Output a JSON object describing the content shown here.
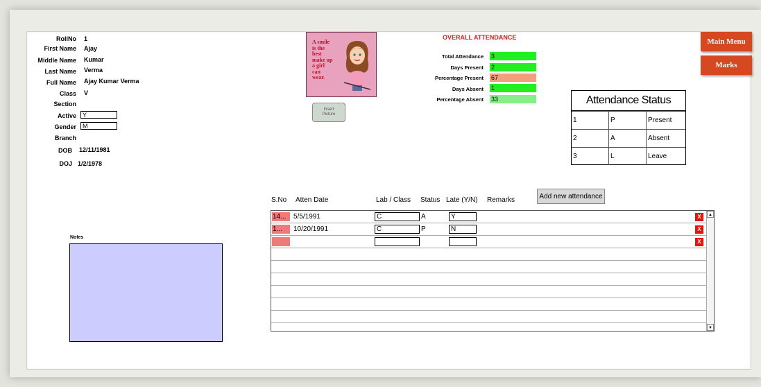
{
  "student": {
    "fields": [
      {
        "label": "RollNo",
        "value": "1"
      },
      {
        "label": "First Name",
        "value": "Ajay"
      },
      {
        "label": "Middle Name",
        "value": "Kumar"
      },
      {
        "label": "Last Name",
        "value": "Verma"
      },
      {
        "label": "Full Name",
        "value": "Ajay Kumar Verma"
      },
      {
        "label": "Class",
        "value": "V"
      },
      {
        "label": "Section",
        "value": ""
      }
    ],
    "active_label": "Active",
    "active_value": "Y",
    "gender_label": "Gender",
    "gender_value": "M",
    "branch_label": "Branch",
    "dob_label": "DOB",
    "dob_value": "12/11/1981",
    "doj_label": "DOJ",
    "doj_value": "1/2/1978"
  },
  "photo": {
    "quote_lines": [
      "A smile",
      "is the",
      "best",
      "make up",
      "a girl",
      "can",
      "wear."
    ],
    "insert_label_1": "Insert",
    "insert_label_2": "Picture"
  },
  "overall": {
    "title": "OVERALL ATTENDANCE",
    "stats": [
      {
        "label": "Total Attendance",
        "value": "3",
        "color": "#22ee22"
      },
      {
        "label": "Days Present",
        "value": "2",
        "color": "#22ee22"
      },
      {
        "label": "Percentage Present",
        "value": "67",
        "color": "#f2a07c"
      },
      {
        "label": "Days Absent",
        "value": "1",
        "color": "#22ee22"
      },
      {
        "label": "Percentage Absent",
        "value": "33",
        "color": "#88ee88"
      }
    ]
  },
  "nav": {
    "main_menu": "Main Menu",
    "marks": "Marks"
  },
  "legend": {
    "title": "Attendance Status",
    "rows": [
      {
        "n": "1",
        "code": "P",
        "text": "Present"
      },
      {
        "n": "2",
        "code": "A",
        "text": "Absent"
      },
      {
        "n": "3",
        "code": "L",
        "text": "Leave"
      }
    ]
  },
  "grid": {
    "headers": {
      "sno": "S.No",
      "date": "Atten Date",
      "lab": "Lab / Class",
      "status": "Status",
      "late": "Late (Y/N)",
      "remarks": "Remarks"
    },
    "add_label": "Add new attendance",
    "rows": [
      {
        "sno": "14...",
        "date": "5/5/1991",
        "lab": "C",
        "status": "A",
        "late": "Y"
      },
      {
        "sno": "1...",
        "date": "10/20/1991",
        "lab": "C",
        "status": "P",
        "late": "N"
      },
      {
        "sno": "",
        "date": "",
        "lab": "",
        "status": "",
        "late": ""
      }
    ],
    "delete_label": "X"
  },
  "notes": {
    "label": "Notes"
  }
}
